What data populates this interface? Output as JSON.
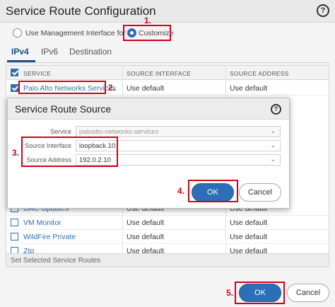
{
  "outer": {
    "title": "Service Route Configuration",
    "help_glyph": "?",
    "radio_management": "Use Management Interface for all",
    "radio_customize": "Customize",
    "tabs": [
      "IPv4",
      "IPv6",
      "Destination"
    ],
    "columns": [
      "SERVICE",
      "SOURCE INTERFACE",
      "SOURCE ADDRESS"
    ],
    "rows_top": [
      {
        "service": "Palo Alto Networks Services",
        "interface": "Use default",
        "address": "Use default",
        "checked": true
      }
    ],
    "rows_bottom": [
      {
        "service": "UAC Updates",
        "interface": "Use default",
        "address": "Use default"
      },
      {
        "service": "VM Monitor",
        "interface": "Use default",
        "address": "Use default"
      },
      {
        "service": "WildFire Private",
        "interface": "Use default",
        "address": "Use default"
      },
      {
        "service": "Ztp",
        "interface": "Use default",
        "address": "Use default"
      }
    ],
    "footer_label": "Set Selected Service Routes",
    "ok_label": "OK",
    "cancel_label": "Cancel"
  },
  "modal": {
    "title": "Service Route Source",
    "help_glyph": "?",
    "service_label": "Service",
    "service_value": "paloalto-networks-services",
    "interface_label": "Source Interface",
    "interface_value": "loopback.10",
    "address_label": "Source Address",
    "address_value": "192.0.2.10",
    "ok_label": "OK",
    "cancel_label": "Cancel"
  },
  "annotations": {
    "step1": "1.",
    "step2": "2.",
    "step3": "3.",
    "step4": "4.",
    "step5": "5."
  },
  "colors": {
    "accent": "#2c6fb6",
    "annotation": "#d0021b"
  }
}
